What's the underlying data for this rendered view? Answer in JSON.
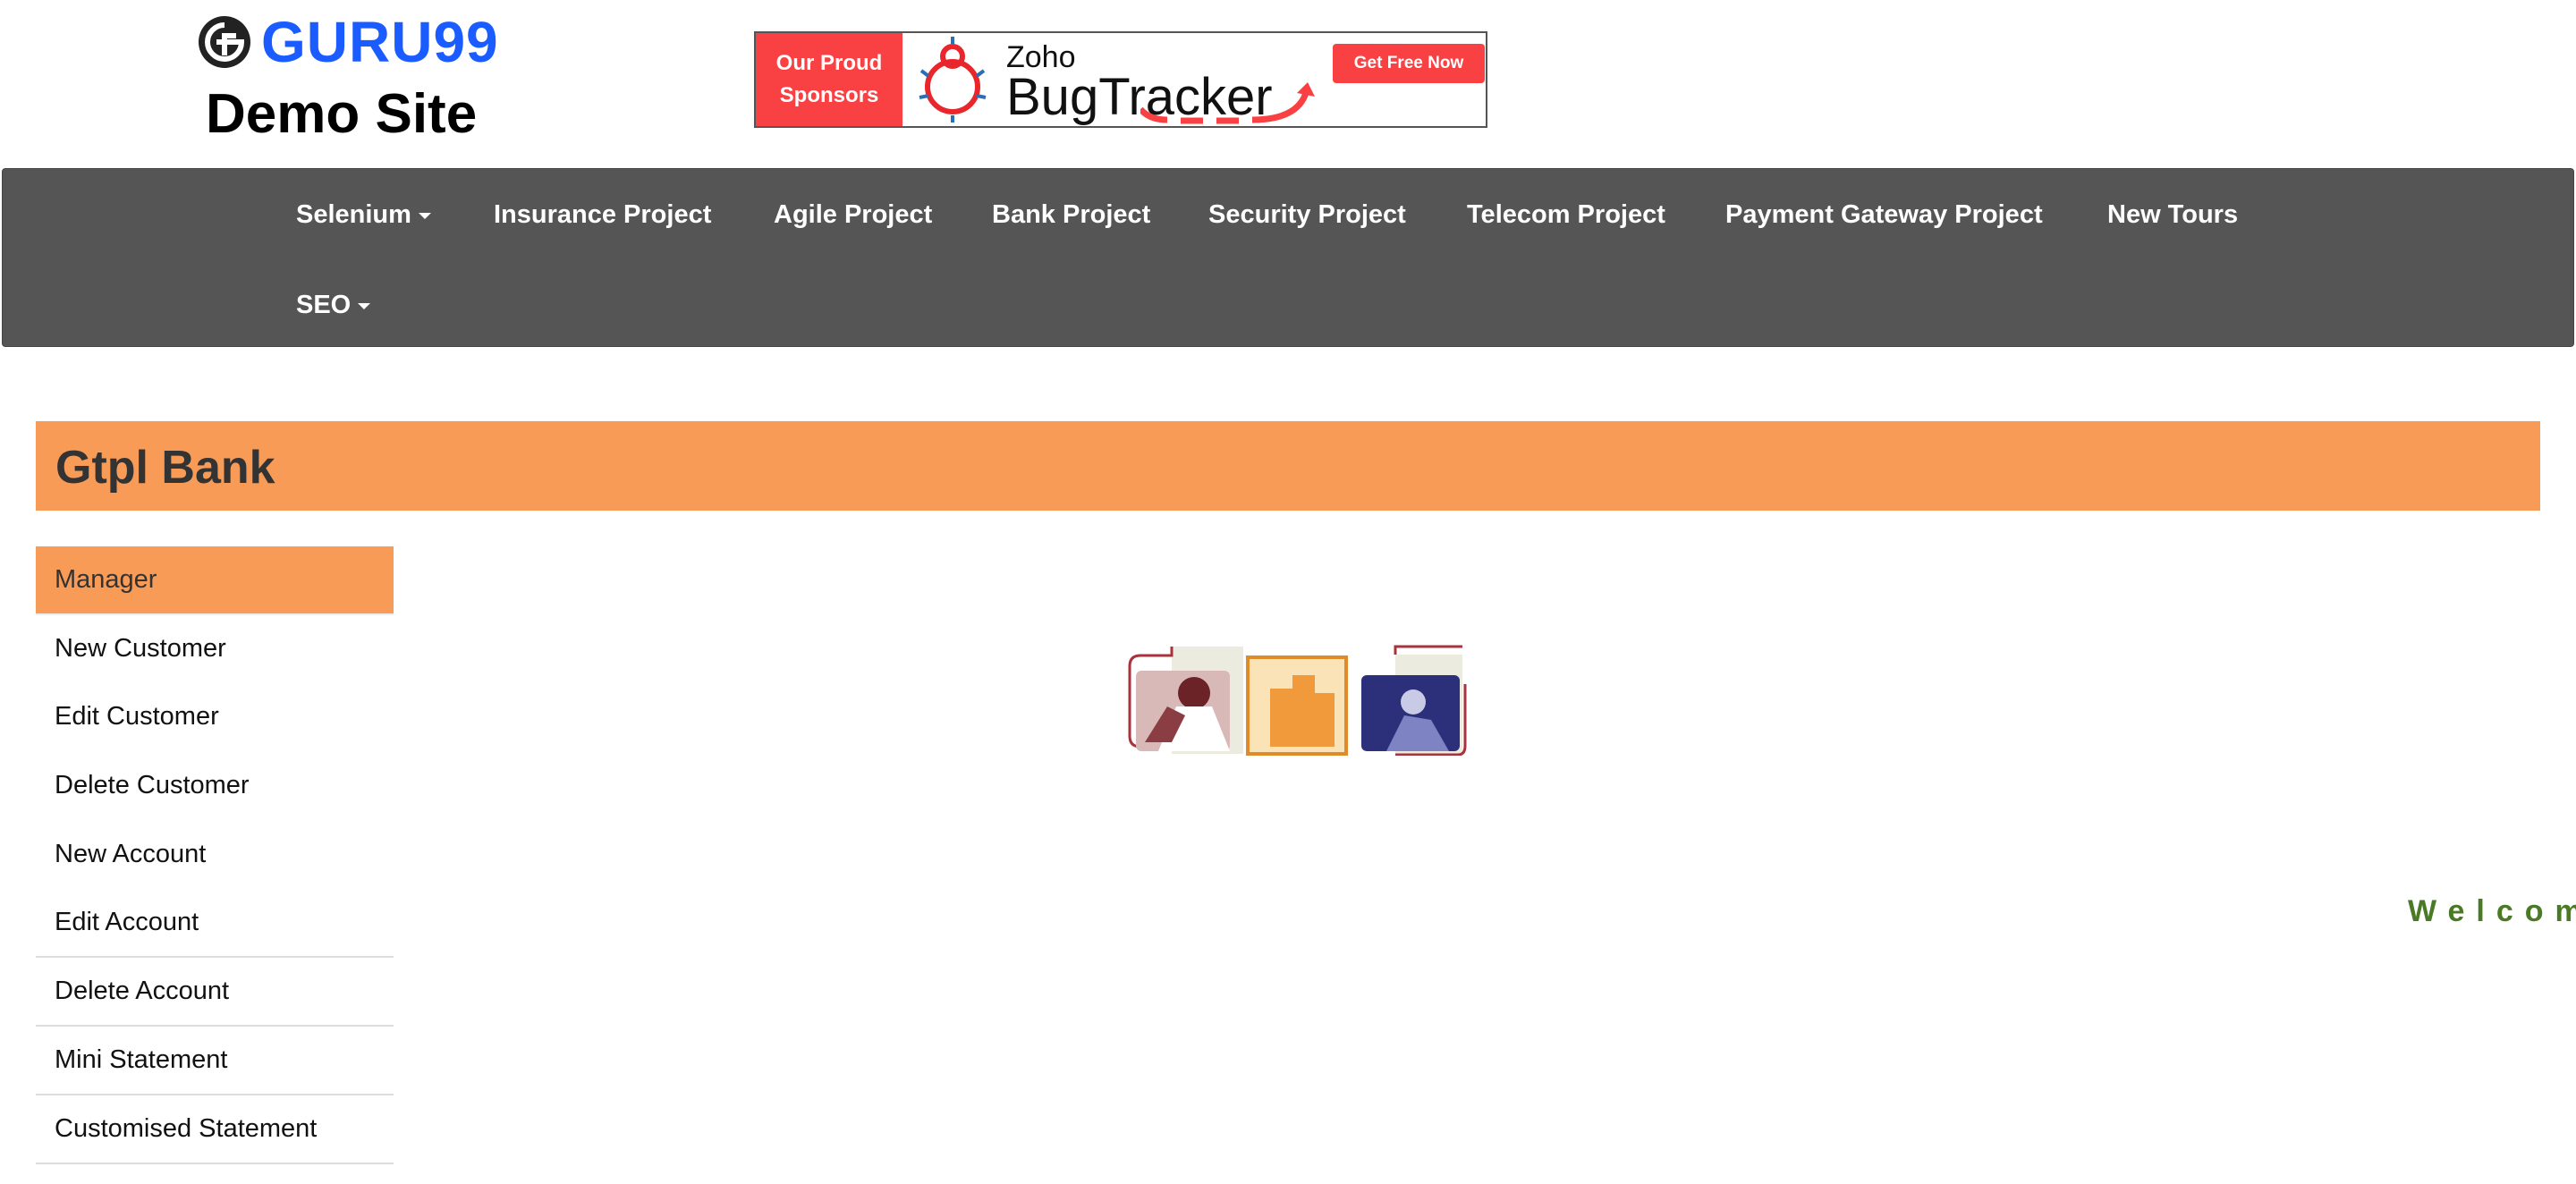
{
  "logo": {
    "brand": "GURU99",
    "subtitle": "Demo Site"
  },
  "banner": {
    "sponsor_line1": "Our Proud",
    "sponsor_line2": "Sponsors",
    "product_brand": "Zoho",
    "product_name": "BugTracker",
    "cta": "Get Free Now"
  },
  "nav": {
    "items": [
      {
        "label": "Selenium",
        "dropdown": true
      },
      {
        "label": "Insurance Project"
      },
      {
        "label": "Agile Project"
      },
      {
        "label": "Bank Project"
      },
      {
        "label": "Security Project"
      },
      {
        "label": "Telecom Project"
      },
      {
        "label": "Payment Gateway Project"
      },
      {
        "label": "New Tours"
      },
      {
        "label": "SEO",
        "dropdown": true
      }
    ]
  },
  "page": {
    "title": "Gtpl Bank",
    "welcome": "Welcome"
  },
  "sidebar": {
    "items": [
      {
        "label": "Manager"
      },
      {
        "label": "New Customer"
      },
      {
        "label": "Edit Customer"
      },
      {
        "label": "Delete Customer"
      },
      {
        "label": "New Account"
      },
      {
        "label": "Edit Account"
      },
      {
        "label": "Delete Account"
      },
      {
        "label": "Mini Statement"
      },
      {
        "label": "Customised Statement"
      }
    ]
  },
  "colors": {
    "accent": "#f89b57",
    "nav_bg": "#555555",
    "welcome": "#4a7a25",
    "brand_blue": "#1a5cff",
    "sponsor_red": "#f94144"
  }
}
